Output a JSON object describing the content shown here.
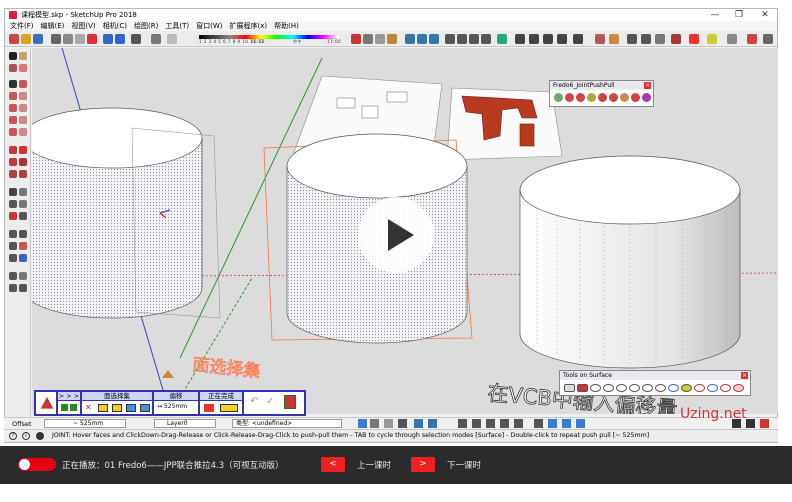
{
  "window": {
    "title": "课程模型.skp - SketchUp Pro 2018",
    "controls": {
      "minimize": "—",
      "maximize": "❐",
      "close": "✕"
    }
  },
  "menu": [
    "文件(F)",
    "编辑(E)",
    "视图(V)",
    "相机(C)",
    "绘图(R)",
    "工具(T)",
    "窗口(W)",
    "扩展程序(x)",
    "帮助(H)"
  ],
  "shadow_palette": {
    "months": "1 2 3 4 5 6 7 8 9 10 11 12",
    "time_start": "06:55",
    "time_mid": "中午",
    "time_end": "17:00"
  },
  "fredo_panel": {
    "title": "Fredo6_JointPushPull"
  },
  "tos_panel": {
    "title": "Tools on Surface"
  },
  "jpp_toolbar": {
    "arrows": "> > >",
    "select_label": "面选择集",
    "offset_label": "偏移",
    "offset_value": "↔ 525mm",
    "finish_label": "正在完成"
  },
  "offset_bar": {
    "label": "Offset",
    "value": "~ 525mm",
    "layer": "Layer0",
    "type_label": "类型: <undefined>"
  },
  "status": {
    "text": "JOINT: Hover faces and ClickDown-Drag-Release or Click-Release-Drag-Click to push-pull them - TAB to cycle through selection modes [Surface] - Double-click to repeat push pull [~ 525mm]"
  },
  "overlay_text": {
    "select_set": "面选择集",
    "caption": "在VCB中输入偏移量"
  },
  "watermark": "Uzing.net",
  "player": {
    "now_playing": "正在播放：01 Fredo6——JPP联合推拉4.3（可视互动版）",
    "prev_button": "<",
    "prev_label": "上一课时",
    "next_button": ">",
    "next_label": "下一课时"
  },
  "colors": {
    "accent": "#e22222",
    "panel_blue": "#3333aa",
    "select_orange": "#ff7040"
  }
}
